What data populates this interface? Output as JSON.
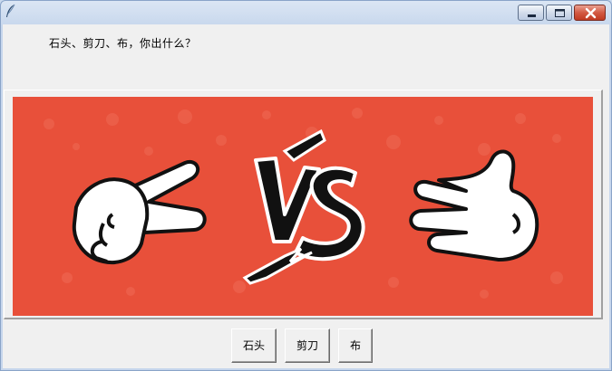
{
  "window": {
    "title": "",
    "controls": [
      "minimize-icon",
      "maximize-icon",
      "close-icon"
    ]
  },
  "prompt": {
    "text": "石头、剪刀、布，你出什么？"
  },
  "image": {
    "background_color": "#e8503a",
    "left_hand": "scissors-hand-icon",
    "center": "vs-icon",
    "right_hand": "paper-hand-icon"
  },
  "buttons": {
    "rock_label": "石头",
    "scissors_label": "剪刀",
    "paper_label": "布"
  }
}
